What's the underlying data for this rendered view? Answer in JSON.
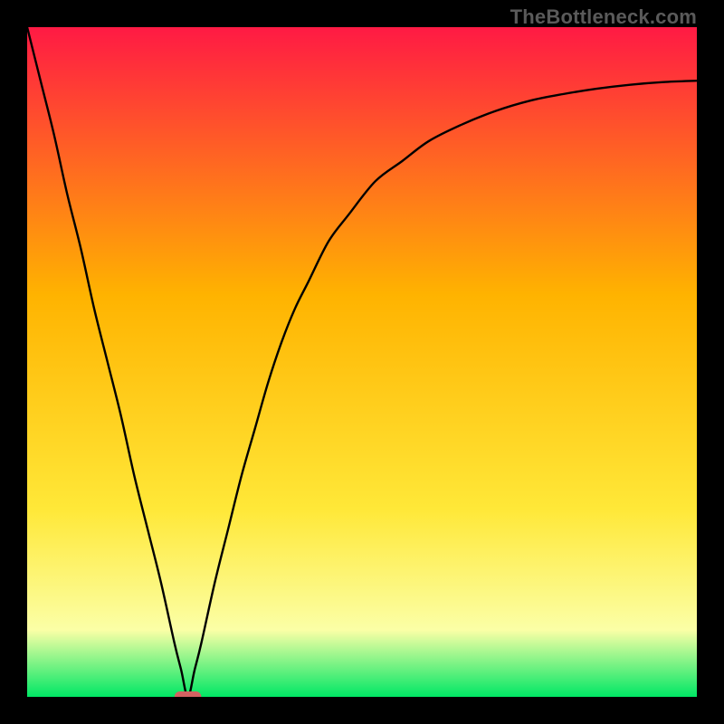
{
  "watermark": "TheBottleneck.com",
  "colors": {
    "frame": "#000000",
    "grad_top": "#ff1a44",
    "grad_mid": "#ffb300",
    "grad_lower": "#ffe838",
    "grad_pale": "#fbffa6",
    "grad_bottom": "#00e765",
    "curve": "#000000",
    "marker": "#d36262"
  },
  "chart_data": {
    "type": "line",
    "title": "",
    "xlabel": "",
    "ylabel": "",
    "xlim": [
      0,
      100
    ],
    "ylim": [
      0,
      100
    ],
    "grid": false,
    "legend": null,
    "annotations": [],
    "marker": {
      "x": 24,
      "y": 0,
      "width": 4
    },
    "series": [
      {
        "name": "bottleneck-curve",
        "x": [
          0,
          2,
          4,
          6,
          8,
          10,
          12,
          14,
          16,
          18,
          20,
          22,
          23,
          24,
          25,
          26,
          28,
          30,
          32,
          34,
          36,
          38,
          40,
          42,
          45,
          48,
          52,
          56,
          60,
          65,
          70,
          75,
          80,
          85,
          90,
          95,
          100
        ],
        "y": [
          100,
          92,
          84,
          75,
          67,
          58,
          50,
          42,
          33,
          25,
          17,
          8,
          4,
          0,
          4,
          8,
          17,
          25,
          33,
          40,
          47,
          53,
          58,
          62,
          68,
          72,
          77,
          80,
          83,
          85.5,
          87.5,
          89,
          90,
          90.8,
          91.4,
          91.8,
          92
        ]
      }
    ]
  }
}
